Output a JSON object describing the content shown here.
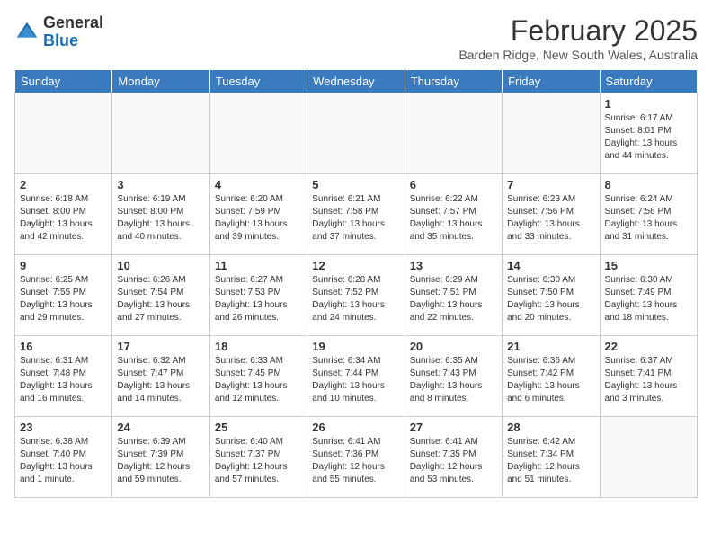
{
  "header": {
    "logo_general": "General",
    "logo_blue": "Blue",
    "month_year": "February 2025",
    "location": "Barden Ridge, New South Wales, Australia"
  },
  "days_of_week": [
    "Sunday",
    "Monday",
    "Tuesday",
    "Wednesday",
    "Thursday",
    "Friday",
    "Saturday"
  ],
  "weeks": [
    [
      {
        "day": "",
        "info": ""
      },
      {
        "day": "",
        "info": ""
      },
      {
        "day": "",
        "info": ""
      },
      {
        "day": "",
        "info": ""
      },
      {
        "day": "",
        "info": ""
      },
      {
        "day": "",
        "info": ""
      },
      {
        "day": "1",
        "info": "Sunrise: 6:17 AM\nSunset: 8:01 PM\nDaylight: 13 hours\nand 44 minutes."
      }
    ],
    [
      {
        "day": "2",
        "info": "Sunrise: 6:18 AM\nSunset: 8:00 PM\nDaylight: 13 hours\nand 42 minutes."
      },
      {
        "day": "3",
        "info": "Sunrise: 6:19 AM\nSunset: 8:00 PM\nDaylight: 13 hours\nand 40 minutes."
      },
      {
        "day": "4",
        "info": "Sunrise: 6:20 AM\nSunset: 7:59 PM\nDaylight: 13 hours\nand 39 minutes."
      },
      {
        "day": "5",
        "info": "Sunrise: 6:21 AM\nSunset: 7:58 PM\nDaylight: 13 hours\nand 37 minutes."
      },
      {
        "day": "6",
        "info": "Sunrise: 6:22 AM\nSunset: 7:57 PM\nDaylight: 13 hours\nand 35 minutes."
      },
      {
        "day": "7",
        "info": "Sunrise: 6:23 AM\nSunset: 7:56 PM\nDaylight: 13 hours\nand 33 minutes."
      },
      {
        "day": "8",
        "info": "Sunrise: 6:24 AM\nSunset: 7:56 PM\nDaylight: 13 hours\nand 31 minutes."
      }
    ],
    [
      {
        "day": "9",
        "info": "Sunrise: 6:25 AM\nSunset: 7:55 PM\nDaylight: 13 hours\nand 29 minutes."
      },
      {
        "day": "10",
        "info": "Sunrise: 6:26 AM\nSunset: 7:54 PM\nDaylight: 13 hours\nand 27 minutes."
      },
      {
        "day": "11",
        "info": "Sunrise: 6:27 AM\nSunset: 7:53 PM\nDaylight: 13 hours\nand 26 minutes."
      },
      {
        "day": "12",
        "info": "Sunrise: 6:28 AM\nSunset: 7:52 PM\nDaylight: 13 hours\nand 24 minutes."
      },
      {
        "day": "13",
        "info": "Sunrise: 6:29 AM\nSunset: 7:51 PM\nDaylight: 13 hours\nand 22 minutes."
      },
      {
        "day": "14",
        "info": "Sunrise: 6:30 AM\nSunset: 7:50 PM\nDaylight: 13 hours\nand 20 minutes."
      },
      {
        "day": "15",
        "info": "Sunrise: 6:30 AM\nSunset: 7:49 PM\nDaylight: 13 hours\nand 18 minutes."
      }
    ],
    [
      {
        "day": "16",
        "info": "Sunrise: 6:31 AM\nSunset: 7:48 PM\nDaylight: 13 hours\nand 16 minutes."
      },
      {
        "day": "17",
        "info": "Sunrise: 6:32 AM\nSunset: 7:47 PM\nDaylight: 13 hours\nand 14 minutes."
      },
      {
        "day": "18",
        "info": "Sunrise: 6:33 AM\nSunset: 7:45 PM\nDaylight: 13 hours\nand 12 minutes."
      },
      {
        "day": "19",
        "info": "Sunrise: 6:34 AM\nSunset: 7:44 PM\nDaylight: 13 hours\nand 10 minutes."
      },
      {
        "day": "20",
        "info": "Sunrise: 6:35 AM\nSunset: 7:43 PM\nDaylight: 13 hours\nand 8 minutes."
      },
      {
        "day": "21",
        "info": "Sunrise: 6:36 AM\nSunset: 7:42 PM\nDaylight: 13 hours\nand 6 minutes."
      },
      {
        "day": "22",
        "info": "Sunrise: 6:37 AM\nSunset: 7:41 PM\nDaylight: 13 hours\nand 3 minutes."
      }
    ],
    [
      {
        "day": "23",
        "info": "Sunrise: 6:38 AM\nSunset: 7:40 PM\nDaylight: 13 hours\nand 1 minute."
      },
      {
        "day": "24",
        "info": "Sunrise: 6:39 AM\nSunset: 7:39 PM\nDaylight: 12 hours\nand 59 minutes."
      },
      {
        "day": "25",
        "info": "Sunrise: 6:40 AM\nSunset: 7:37 PM\nDaylight: 12 hours\nand 57 minutes."
      },
      {
        "day": "26",
        "info": "Sunrise: 6:41 AM\nSunset: 7:36 PM\nDaylight: 12 hours\nand 55 minutes."
      },
      {
        "day": "27",
        "info": "Sunrise: 6:41 AM\nSunset: 7:35 PM\nDaylight: 12 hours\nand 53 minutes."
      },
      {
        "day": "28",
        "info": "Sunrise: 6:42 AM\nSunset: 7:34 PM\nDaylight: 12 hours\nand 51 minutes."
      },
      {
        "day": "",
        "info": ""
      }
    ]
  ]
}
